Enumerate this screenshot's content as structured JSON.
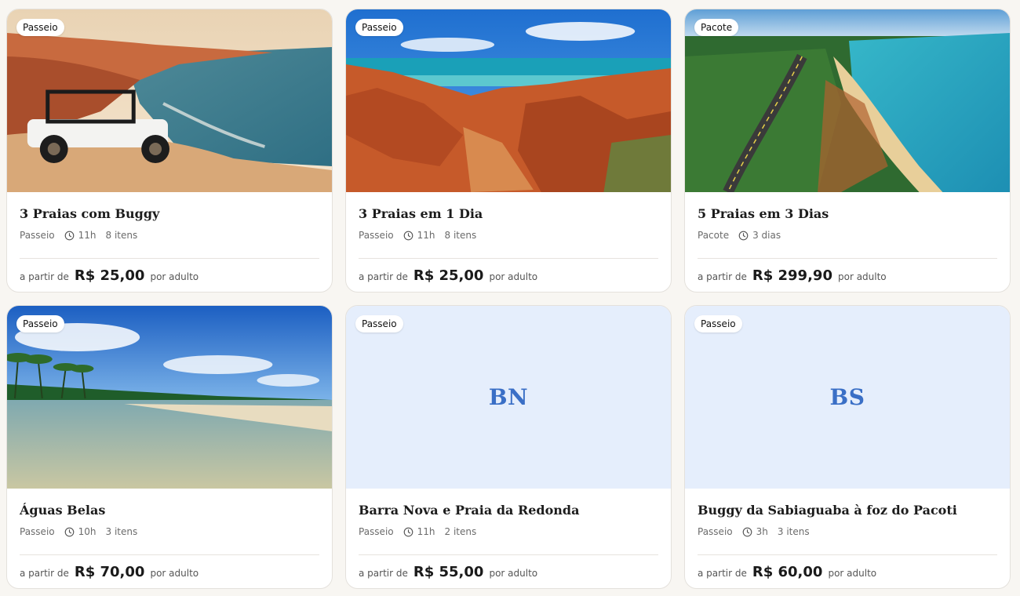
{
  "cards": [
    {
      "badge": "Passeio",
      "image": "buggy-on-beach-cliff",
      "initials": "",
      "title": "3 Praias com Buggy",
      "type": "Passeio",
      "duration": "11h",
      "items": "8 itens",
      "price_prefix": "a partir de",
      "price": "R$ 25,00",
      "price_suffix": "por adulto"
    },
    {
      "badge": "Passeio",
      "image": "red-cliffs-coast",
      "initials": "",
      "title": "3 Praias em 1 Dia",
      "type": "Passeio",
      "duration": "11h",
      "items": "8 itens",
      "price_prefix": "a partir de",
      "price": "R$ 25,00",
      "price_suffix": "por adulto"
    },
    {
      "badge": "Pacote",
      "image": "coastal-road-aerial",
      "initials": "",
      "title": "5 Praias em 3 Dias",
      "type": "Pacote",
      "duration": "3 dias",
      "items": "",
      "price_prefix": "a partir de",
      "price": "R$ 299,90",
      "price_suffix": "por adulto"
    },
    {
      "badge": "Passeio",
      "image": "palm-lagoon",
      "initials": "",
      "title": "Águas Belas",
      "type": "Passeio",
      "duration": "10h",
      "items": "3 itens",
      "price_prefix": "a partir de",
      "price": "R$ 70,00",
      "price_suffix": "por adulto"
    },
    {
      "badge": "Passeio",
      "image": "",
      "initials": "BN",
      "title": "Barra Nova e Praia da Redonda",
      "type": "Passeio",
      "duration": "11h",
      "items": "2 itens",
      "price_prefix": "a partir de",
      "price": "R$ 55,00",
      "price_suffix": "por adulto"
    },
    {
      "badge": "Passeio",
      "image": "",
      "initials": "BS",
      "title": "Buggy da Sabiaguaba à foz do Pacoti",
      "type": "Passeio",
      "duration": "3h",
      "items": "3 itens",
      "price_prefix": "a partir de",
      "price": "R$ 60,00",
      "price_suffix": "por adulto"
    }
  ],
  "icons": {
    "duration": "clock-icon"
  },
  "colors": {
    "placeholder_bg": "#e5eefc",
    "initials": "#3a6fc6",
    "page_bg": "#f8f6f2"
  }
}
